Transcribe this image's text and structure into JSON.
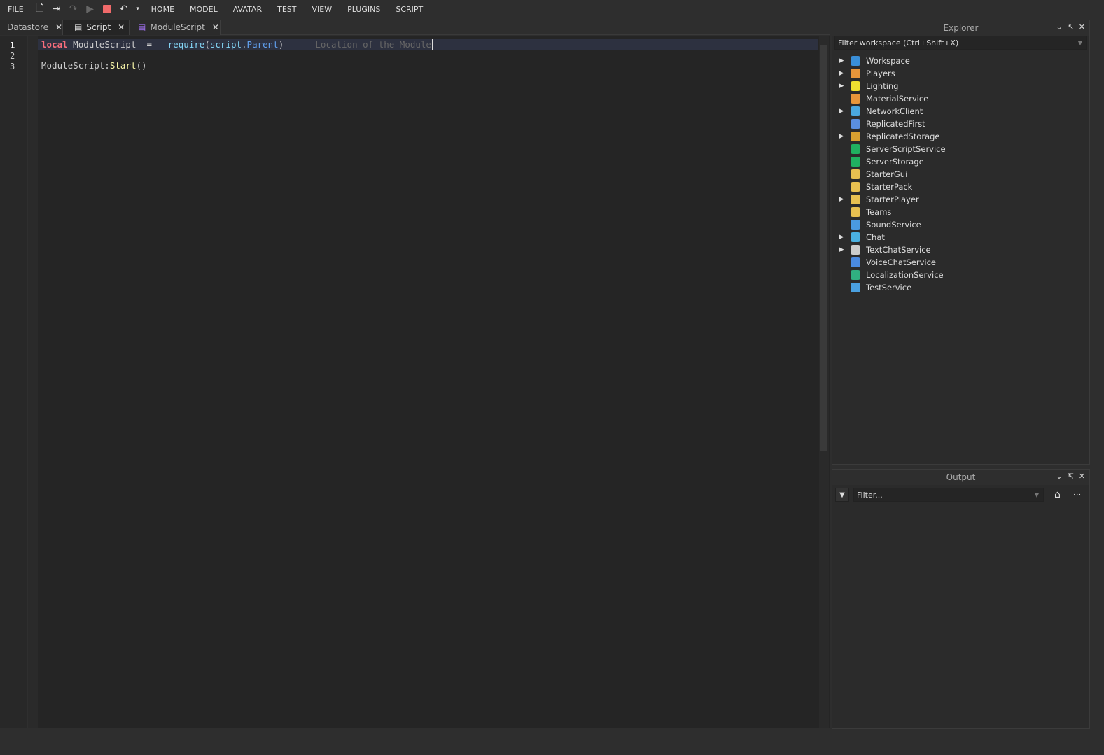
{
  "toolbar": {
    "file": "FILE",
    "menus": [
      "HOME",
      "MODEL",
      "AVATAR",
      "TEST",
      "VIEW",
      "PLUGINS",
      "SCRIPT"
    ]
  },
  "tabs": [
    {
      "label": "Datastore"
    },
    {
      "label": "Script"
    },
    {
      "label": "ModuleScript"
    }
  ],
  "editor": {
    "line_numbers": [
      "1",
      "2",
      "3"
    ],
    "line1": {
      "kw": "local",
      "var": " ModuleScript  =   ",
      "fn": "require",
      "p1": "(",
      "obj": "script",
      "dot": ".",
      "prop": "Parent",
      "p2": ")",
      "comment": "  --  Location of the Module"
    },
    "line3": {
      "a": "ModuleScript:",
      "b": "Start",
      "c": "()"
    }
  },
  "explorer": {
    "title": "Explorer",
    "filter_placeholder": "Filter workspace (Ctrl+Shift+X)",
    "items": [
      {
        "label": "Workspace",
        "expandable": true,
        "color": "#3a8fd8"
      },
      {
        "label": "Players",
        "expandable": true,
        "color": "#e8963a"
      },
      {
        "label": "Lighting",
        "expandable": true,
        "color": "#f0e030"
      },
      {
        "label": "MaterialService",
        "expandable": false,
        "color": "#e8963a"
      },
      {
        "label": "NetworkClient",
        "expandable": true,
        "color": "#4aa8e0"
      },
      {
        "label": "ReplicatedFirst",
        "expandable": false,
        "color": "#5a8fe0"
      },
      {
        "label": "ReplicatedStorage",
        "expandable": true,
        "color": "#d8a030"
      },
      {
        "label": "ServerScriptService",
        "expandable": false,
        "color": "#20b060"
      },
      {
        "label": "ServerStorage",
        "expandable": false,
        "color": "#20b060"
      },
      {
        "label": "StarterGui",
        "expandable": false,
        "color": "#e8c050"
      },
      {
        "label": "StarterPack",
        "expandable": false,
        "color": "#e8c050"
      },
      {
        "label": "StarterPlayer",
        "expandable": true,
        "color": "#e8c050"
      },
      {
        "label": "Teams",
        "expandable": false,
        "color": "#e8c050"
      },
      {
        "label": "SoundService",
        "expandable": false,
        "color": "#4a9ae0"
      },
      {
        "label": "Chat",
        "expandable": true,
        "color": "#4ab0e0"
      },
      {
        "label": "TextChatService",
        "expandable": true,
        "color": "#cccccc"
      },
      {
        "label": "VoiceChatService",
        "expandable": false,
        "color": "#4a8ae0"
      },
      {
        "label": "LocalizationService",
        "expandable": false,
        "color": "#30b080"
      },
      {
        "label": "TestService",
        "expandable": false,
        "color": "#4aa0e0"
      }
    ]
  },
  "output": {
    "title": "Output",
    "filter_placeholder": "Filter...",
    "more": "···"
  }
}
